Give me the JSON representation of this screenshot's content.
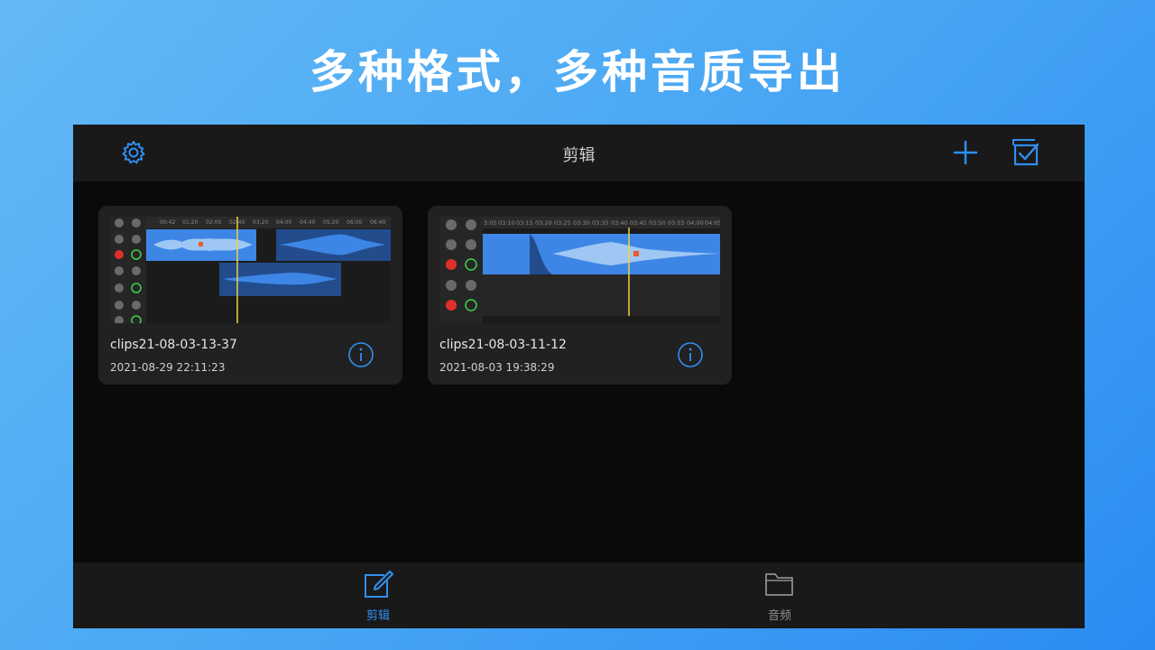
{
  "headline": "多种格式，多种音质导出",
  "navbar": {
    "title": "剪辑",
    "icons": [
      "gear-icon",
      "plus-icon",
      "multi-select-icon"
    ]
  },
  "projects": [
    {
      "name": "clips21-08-03-13-37",
      "date": "2021-08-29 22:11:23",
      "ruler": [
        "00:42",
        "01:20",
        "02:00",
        "02:40",
        "03:20",
        "04:00",
        "04:40",
        "05:20",
        "06:00",
        "06:40"
      ]
    },
    {
      "name": "clips21-08-03-11-12",
      "date": "2021-08-03 19:38:29",
      "ruler": [
        "3:05",
        "03:10",
        "03:15",
        "03:20",
        "03:25",
        "03:30",
        "03:35",
        "03:40",
        "03:45",
        "03:50",
        "03:55",
        "04:00",
        "04:05"
      ]
    }
  ],
  "tabbar": {
    "tabs": [
      {
        "label": "剪辑",
        "icon": "edit-icon",
        "active": true
      },
      {
        "label": "音频",
        "icon": "folder-icon",
        "active": false
      }
    ]
  },
  "colors": {
    "accent": "#2f8ff0",
    "waveform": "#3d86e6",
    "playhead": "#f2d23a",
    "record": "#e0302a"
  }
}
